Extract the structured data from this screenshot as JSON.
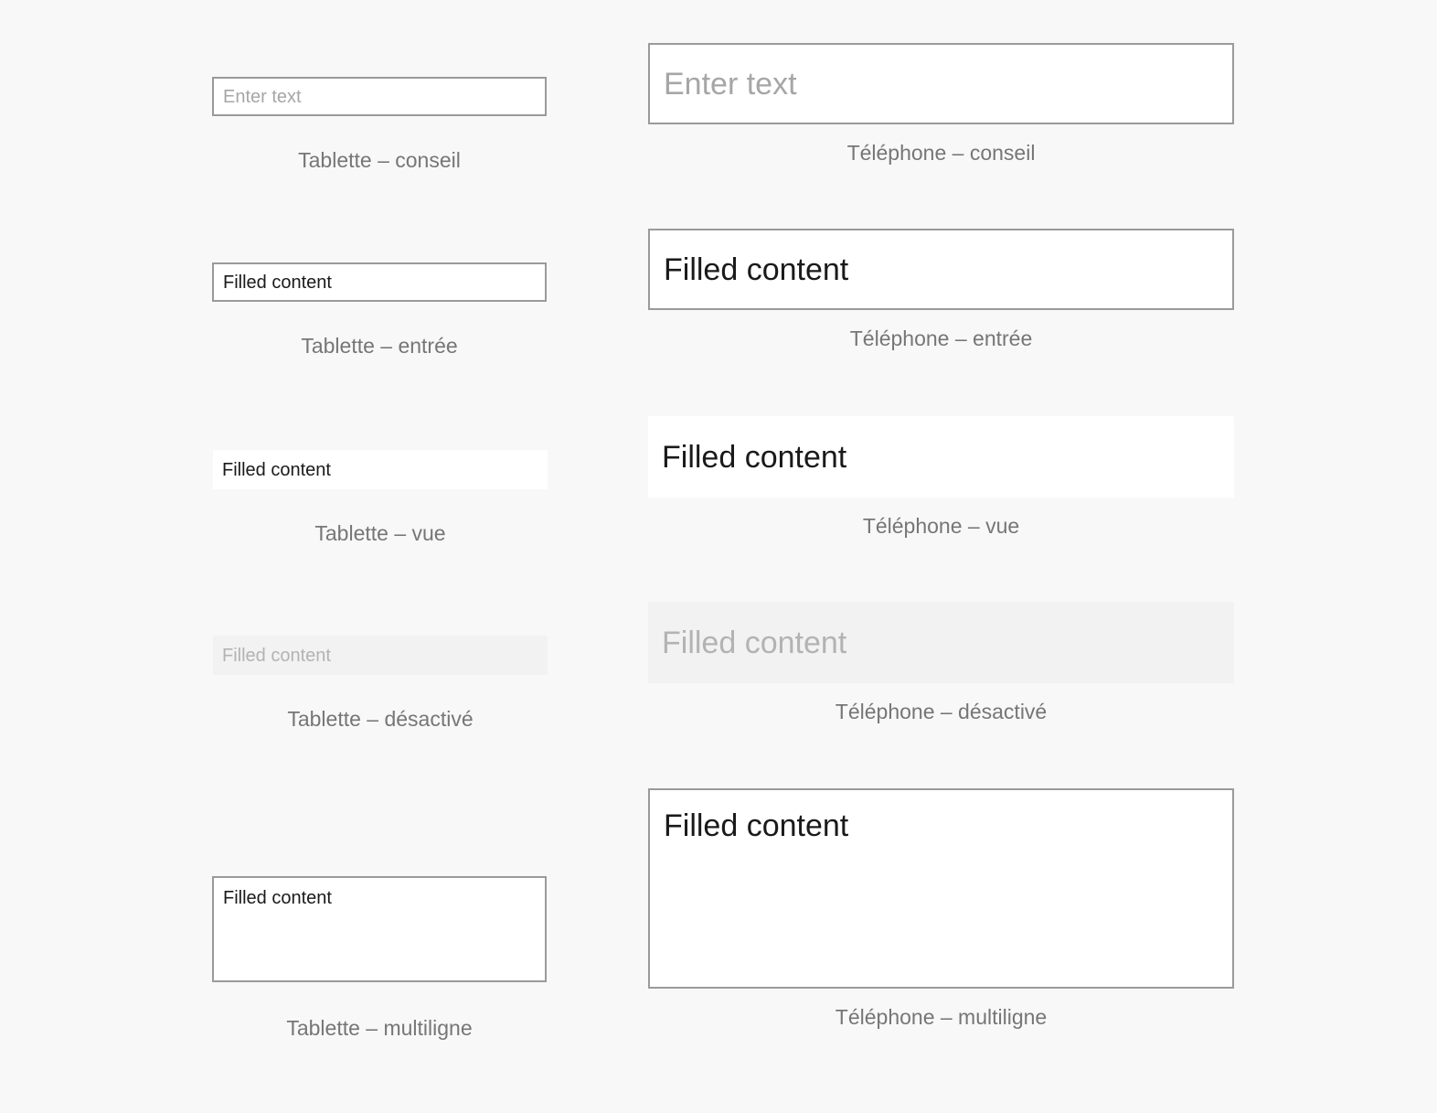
{
  "page": {
    "background_color": "#f8f8f8",
    "border_color": "#9a9a9a",
    "disabled_background_color": "#f2f2f2",
    "caption_color": "#767676",
    "placeholder_color": "#a6a6a6",
    "text_color": "#1a1a1a",
    "disabled_text_color": "#b3b3b3"
  },
  "columns": {
    "tablet": {
      "name": "Tablette",
      "rows": [
        {
          "key": "hint",
          "state": "hint",
          "value": "Enter text",
          "placeholder": "Enter text",
          "caption": "Tablette – conseil"
        },
        {
          "key": "input",
          "state": "input",
          "value": "Filled content",
          "placeholder": "Enter text",
          "caption": "Tablette – entrée"
        },
        {
          "key": "view",
          "state": "view",
          "value": "Filled content",
          "placeholder": "Enter text",
          "caption": "Tablette – vue"
        },
        {
          "key": "disabled",
          "state": "disabled",
          "value": "Filled content",
          "placeholder": "Enter text",
          "caption": "Tablette – désactivé"
        },
        {
          "key": "multiline",
          "state": "multiline",
          "value": "Filled content",
          "placeholder": "Enter text",
          "caption": "Tablette – multiligne"
        }
      ]
    },
    "phone": {
      "name": "Téléphone",
      "rows": [
        {
          "key": "hint",
          "state": "hint",
          "value": "Enter text",
          "placeholder": "Enter text",
          "caption": "Téléphone – conseil"
        },
        {
          "key": "input",
          "state": "input",
          "value": "Filled content",
          "placeholder": "Enter text",
          "caption": "Téléphone – entrée"
        },
        {
          "key": "view",
          "state": "view",
          "value": "Filled content",
          "placeholder": "Enter text",
          "caption": "Téléphone – vue"
        },
        {
          "key": "disabled",
          "state": "disabled",
          "value": "Filled content",
          "placeholder": "Enter text",
          "caption": "Téléphone – désactivé"
        },
        {
          "key": "multiline",
          "state": "multiline",
          "value": "Filled content",
          "placeholder": "Enter text",
          "caption": "Téléphone – multiligne"
        }
      ]
    }
  }
}
